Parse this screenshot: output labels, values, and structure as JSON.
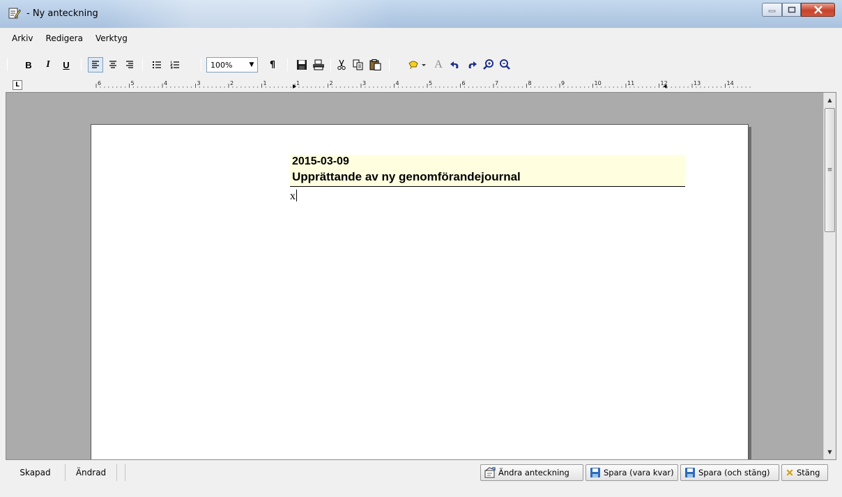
{
  "window": {
    "title": " - Ny anteckning",
    "icon": "note-edit-icon"
  },
  "menu": [
    "Arkiv",
    "Redigera",
    "Verktyg"
  ],
  "toolbar": {
    "bold_label": "B",
    "italic_label": "I",
    "underline_label": "U",
    "zoom_value": "100%",
    "pilcrow_label": "¶",
    "font_color_label": "A",
    "icons": [
      "bold-icon",
      "italic-icon",
      "underline-icon",
      "align-left-icon",
      "align-center-icon",
      "align-right-icon",
      "bullet-list-icon",
      "numbered-list-icon",
      "zoom-select",
      "paragraph-marks-icon",
      "save-icon",
      "print-icon",
      "cut-icon",
      "copy-icon",
      "paste-icon",
      "highlight-icon",
      "font-color-icon",
      "undo-icon",
      "redo-icon",
      "zoom-in-icon",
      "zoom-out-icon"
    ]
  },
  "ruler": {
    "tab_stop_label": "L",
    "left_labels": [
      "6",
      "5",
      "4",
      "3",
      "2",
      "1"
    ],
    "right_labels": [
      "1",
      "2",
      "3",
      "4",
      "5",
      "6",
      "7",
      "8",
      "9",
      "10",
      "11",
      "12",
      "13",
      "14"
    ]
  },
  "document": {
    "date": "2015-03-09",
    "title": "Upprättande av ny genomförandejournal",
    "body": "x"
  },
  "status": {
    "created_label": "Skapad",
    "changed_label": "Ändrad"
  },
  "actions": {
    "edit_label": "Ändra anteckning",
    "save_stay_label": "Spara (vara kvar)",
    "save_close_label": "Spara (och stäng)",
    "close_label": "Stäng"
  },
  "colors": {
    "header_highlight": "#ffffe0",
    "editor_background": "#ababab",
    "close_button": "#c7432b",
    "close_x": "#d4a017"
  }
}
